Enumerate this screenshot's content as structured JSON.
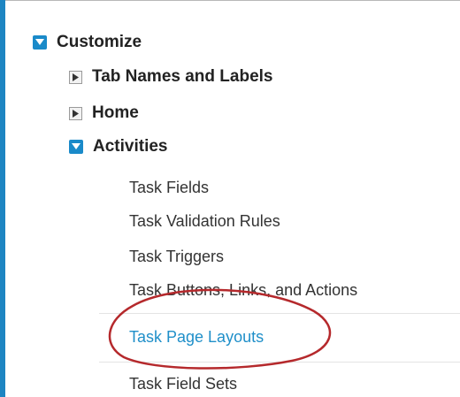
{
  "tree": {
    "root": {
      "label": "Customize",
      "icon": "collapse-icon",
      "expanded": true
    },
    "children": [
      {
        "label": "Tab Names and Labels",
        "icon": "expand-icon",
        "expanded": false
      },
      {
        "label": "Home",
        "icon": "expand-icon",
        "expanded": false
      },
      {
        "label": "Activities",
        "icon": "collapse-icon",
        "expanded": true
      }
    ],
    "activities_items": [
      "Task Fields",
      "Task Validation Rules",
      "Task Triggers",
      "Task Buttons, Links, and Actions",
      "Task Page Layouts",
      "Task Field Sets"
    ],
    "selected_item": "Task Page Layouts"
  },
  "colors": {
    "accent": "#1a8ac9",
    "link": "#1f8fc9",
    "highlight_ellipse": "#b5292c",
    "text": "#222222"
  }
}
